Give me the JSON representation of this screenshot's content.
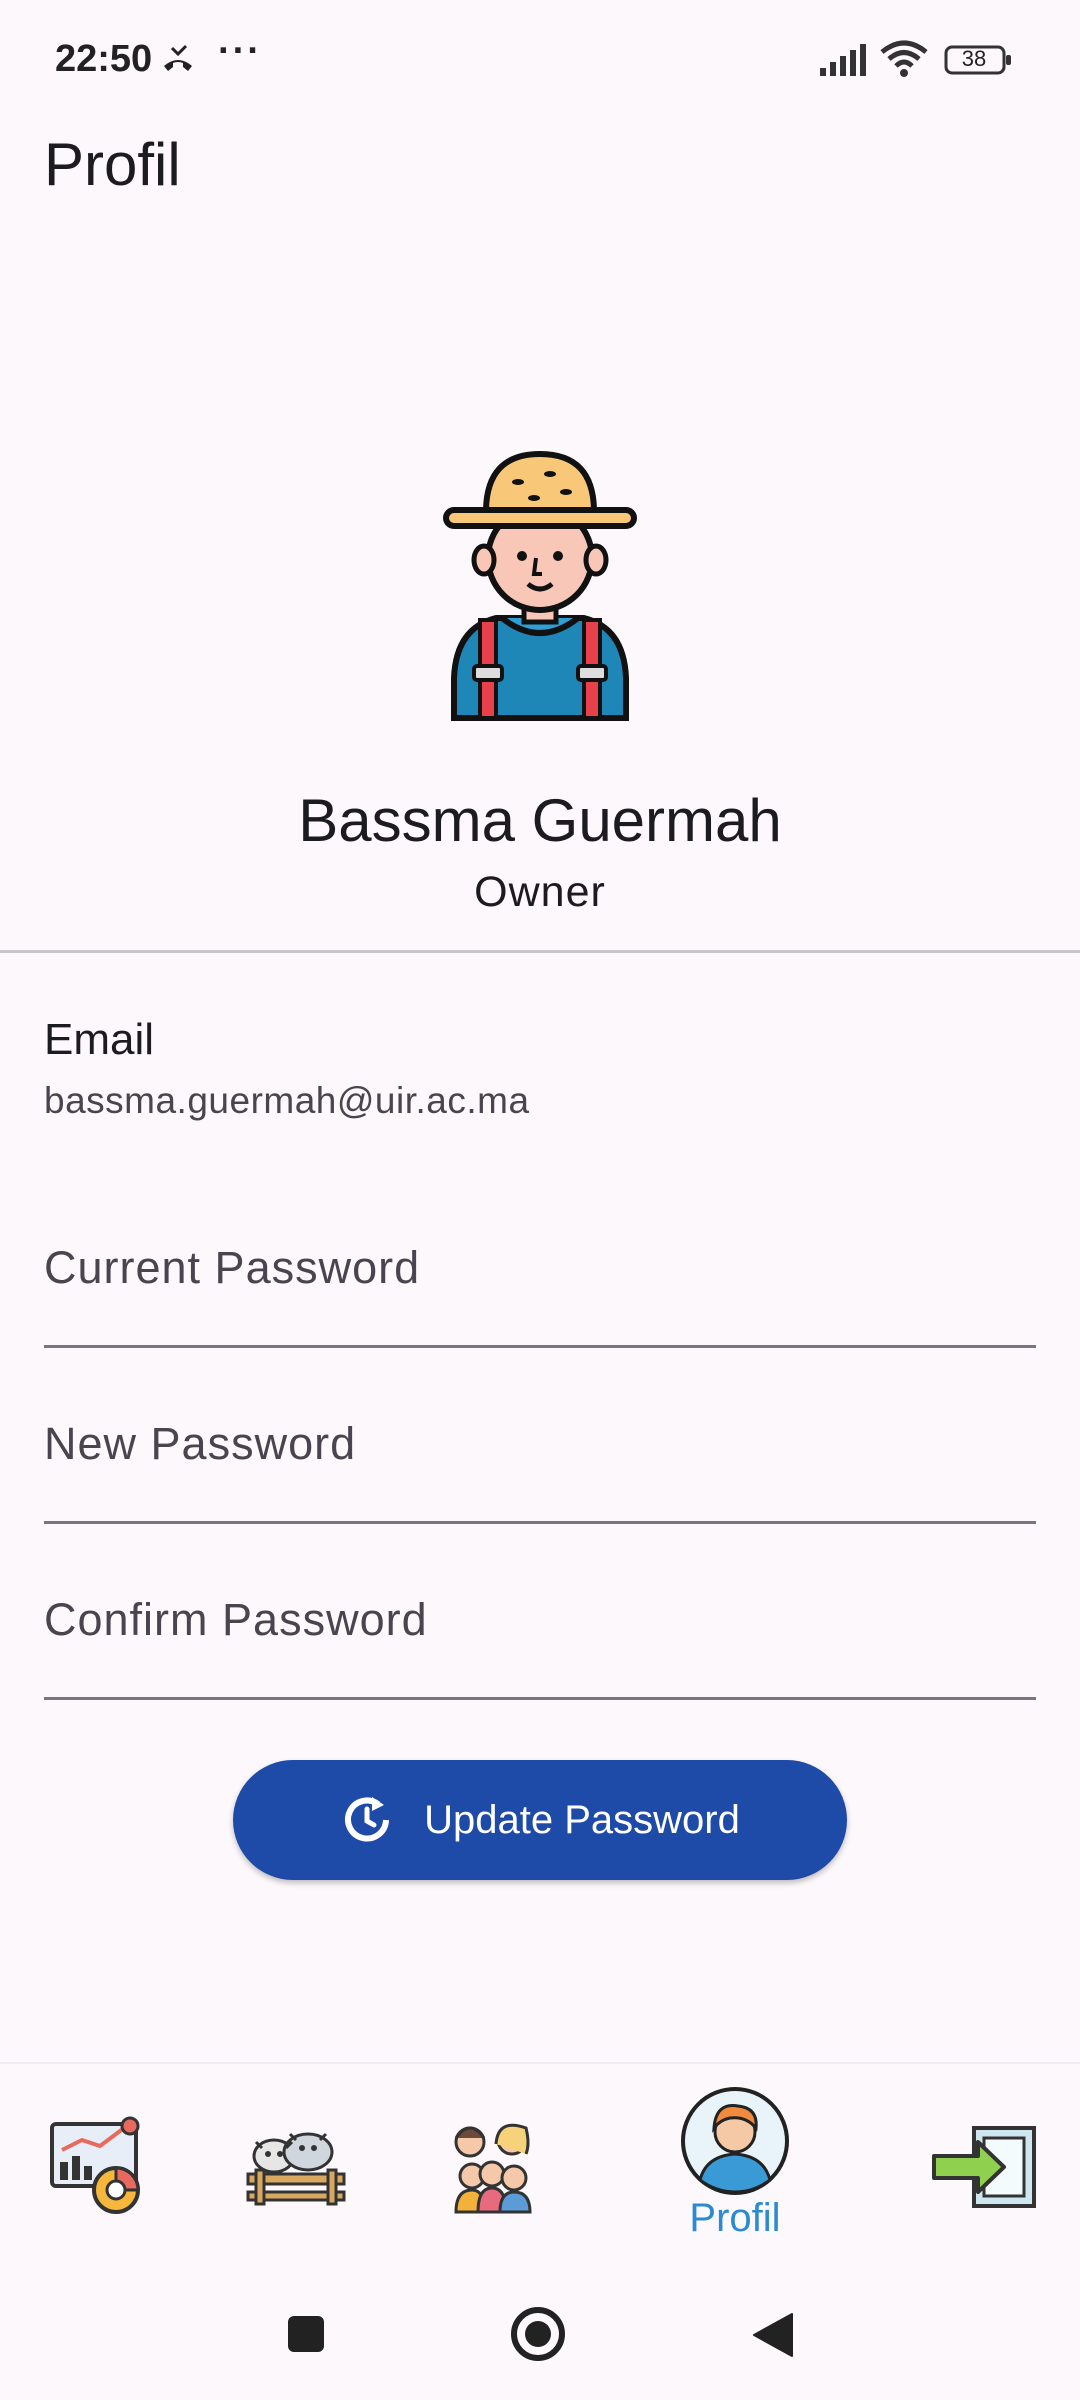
{
  "status_bar": {
    "time": "22:50",
    "dots": "···",
    "battery": "38"
  },
  "app_bar": {
    "title": "Profil"
  },
  "profile": {
    "name": "Bassma Guermah",
    "role": "Owner"
  },
  "email": {
    "label": "Email",
    "value": "bassma.guermah@uir.ac.ma"
  },
  "fields": [
    {
      "label": "Current Password",
      "value": ""
    },
    {
      "label": "New Password",
      "value": ""
    },
    {
      "label": "Confirm Password",
      "value": ""
    }
  ],
  "update_button": {
    "label": "Update Password",
    "icon": "refresh-clock-icon",
    "color": "#1e4aa8"
  },
  "bottom_nav": {
    "items": [
      {
        "icon": "dashboard-chart-icon",
        "label": ""
      },
      {
        "icon": "livestock-cows-icon",
        "label": ""
      },
      {
        "icon": "team-people-icon",
        "label": ""
      },
      {
        "icon": "profile-avatar-icon",
        "label": "Profil",
        "active": true
      },
      {
        "icon": "logout-arrow-icon",
        "label": ""
      }
    ],
    "active_color": "#2a8bd0"
  },
  "system_nav": {
    "buttons": [
      "recents-square-icon",
      "home-circle-icon",
      "back-triangle-icon"
    ]
  }
}
